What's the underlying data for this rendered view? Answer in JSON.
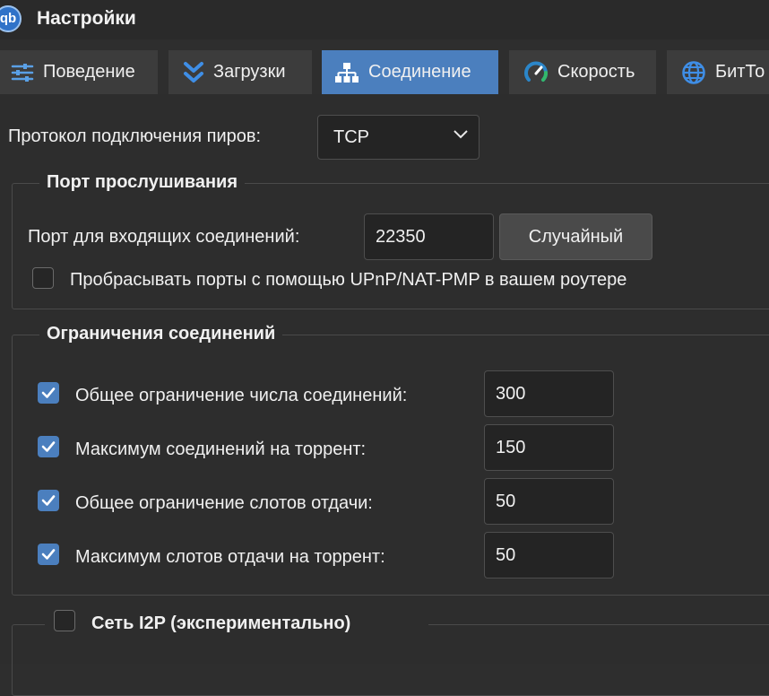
{
  "window": {
    "title": "Настройки",
    "logo_text": "qb"
  },
  "tabs": [
    {
      "label": "Поведение",
      "icon": "sliders-icon",
      "active": false
    },
    {
      "label": "Загрузки",
      "icon": "double-chevron-down-icon",
      "active": false
    },
    {
      "label": "Соединение",
      "icon": "network-icon",
      "active": true
    },
    {
      "label": "Скорость",
      "icon": "speedometer-icon",
      "active": false
    },
    {
      "label": "БитТо",
      "icon": "globe-icon",
      "active": false
    }
  ],
  "protocol": {
    "label": "Протокол подключения пиров:",
    "value": "TCP"
  },
  "listening_port": {
    "title": "Порт прослушивания",
    "port_label": "Порт для входящих соединений:",
    "port_value": "22350",
    "random_button": "Случайный",
    "upnp_label": "Пробрасывать порты с помощью UPnP/NAT-PMP в вашем роутере",
    "upnp_checked": false
  },
  "connection_limits": {
    "title": "Ограничения соединений",
    "rows": [
      {
        "label": "Общее ограничение числа соединений:",
        "value": "300",
        "checked": true
      },
      {
        "label": "Максимум соединений на торрент:",
        "value": "150",
        "checked": true
      },
      {
        "label": "Общее ограничение слотов отдачи:",
        "value": "50",
        "checked": true
      },
      {
        "label": "Максимум слотов отдачи на торрент:",
        "value": "50",
        "checked": true
      }
    ]
  },
  "i2p": {
    "title": "Сеть I2P (экспериментально)",
    "checked": false
  },
  "colors": {
    "accent": "#4b7fbe",
    "background": "#2d2d2d",
    "tab_bg": "#3c3c3c"
  }
}
